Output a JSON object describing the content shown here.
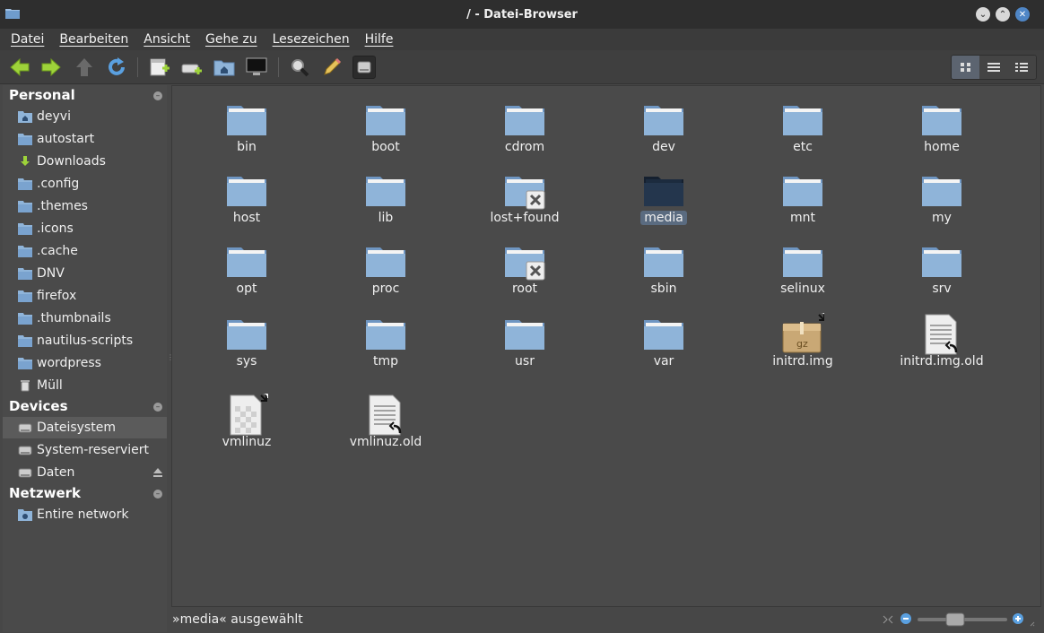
{
  "window": {
    "title": "/ - Datei-Browser"
  },
  "menu": [
    "Datei",
    "Bearbeiten",
    "Ansicht",
    "Gehe zu",
    "Lesezeichen",
    "Hilfe"
  ],
  "toolbar": {
    "buttons": [
      "back-icon",
      "forward-icon",
      "up-icon",
      "reload-icon",
      "new-folder-icon",
      "new-computer-icon",
      "home-folder-icon",
      "computer-icon",
      "search-icon",
      "edit-location-icon",
      "filesystem-icon"
    ],
    "view_modes": [
      "icon-view-icon",
      "list-view-icon",
      "compact-view-icon"
    ]
  },
  "sidebar": {
    "personal": {
      "header": "Personal",
      "items": [
        "deyvi",
        "autostart",
        "Downloads",
        ".config",
        ".themes",
        ".icons",
        ".cache",
        "DNV",
        "firefox",
        ".thumbnails",
        "nautilus-scripts",
        "wordpress",
        "Müll"
      ]
    },
    "devices": {
      "header": "Devices",
      "items": [
        "Dateisystem",
        "System-reserviert",
        "Daten"
      ]
    },
    "network": {
      "header": "Netzwerk",
      "items": [
        "Entire network"
      ]
    }
  },
  "files": [
    {
      "name": "bin",
      "type": "folder"
    },
    {
      "name": "boot",
      "type": "folder"
    },
    {
      "name": "cdrom",
      "type": "folder"
    },
    {
      "name": "dev",
      "type": "folder"
    },
    {
      "name": "etc",
      "type": "folder"
    },
    {
      "name": "home",
      "type": "folder"
    },
    {
      "name": "host",
      "type": "folder"
    },
    {
      "name": "lib",
      "type": "folder"
    },
    {
      "name": "lost+found",
      "type": "folder-locked"
    },
    {
      "name": "media",
      "type": "folder-selected"
    },
    {
      "name": "mnt",
      "type": "folder"
    },
    {
      "name": "my",
      "type": "folder"
    },
    {
      "name": "opt",
      "type": "folder"
    },
    {
      "name": "proc",
      "type": "folder"
    },
    {
      "name": "root",
      "type": "folder-locked"
    },
    {
      "name": "sbin",
      "type": "folder"
    },
    {
      "name": "selinux",
      "type": "folder"
    },
    {
      "name": "srv",
      "type": "folder"
    },
    {
      "name": "sys",
      "type": "folder"
    },
    {
      "name": "tmp",
      "type": "folder"
    },
    {
      "name": "usr",
      "type": "folder"
    },
    {
      "name": "var",
      "type": "folder"
    },
    {
      "name": "initrd.img",
      "type": "archive-link",
      "badge": "gz"
    },
    {
      "name": "initrd.img.old",
      "type": "text-link"
    },
    {
      "name": "vmlinuz",
      "type": "binary-link"
    },
    {
      "name": "vmlinuz.old",
      "type": "text-link"
    }
  ],
  "status": {
    "text": "»media« ausgewählt",
    "zoom_fraction": 0.4
  },
  "colors": {
    "folder": "#8fb4d9",
    "folder_selected": "#24364d",
    "accent": "#4f86c6"
  }
}
